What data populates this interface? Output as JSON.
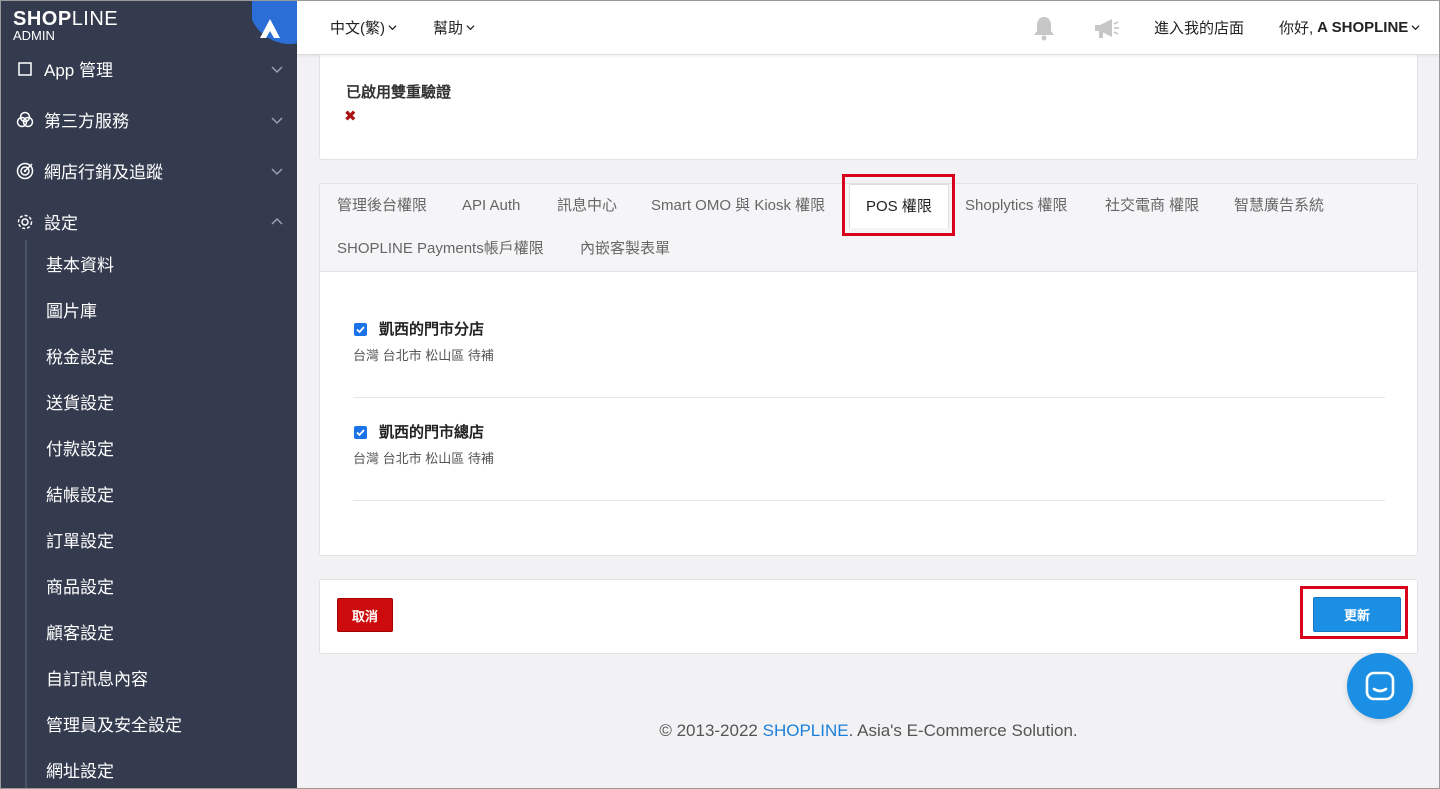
{
  "brand": {
    "logo_bold": "SHOP",
    "logo_thin": "LINE",
    "sub": "ADMIN"
  },
  "sidebar": {
    "items": [
      {
        "label": "App 管理",
        "icon": "app-icon"
      },
      {
        "label": "第三方服務",
        "icon": "third-party-icon"
      },
      {
        "label": "網店行銷及追蹤",
        "icon": "target-icon"
      },
      {
        "label": "設定",
        "icon": "gear-icon"
      }
    ],
    "settings_subitems": [
      "基本資料",
      "圖片庫",
      "稅金設定",
      "送貨設定",
      "付款設定",
      "結帳設定",
      "訂單設定",
      "商品設定",
      "顧客設定",
      "自訂訊息內容",
      "管理員及安全設定",
      "網址設定"
    ]
  },
  "topbar": {
    "language": "中文(繁)",
    "help": "幫助",
    "enter_store": "進入我的店面",
    "greeting": "你好, ",
    "user": "A SHOPLINE"
  },
  "security": {
    "two_factor_label": "已啟用雙重驗證",
    "two_factor_value": "✖"
  },
  "tabs": [
    "管理後台權限",
    "API Auth",
    "訊息中心",
    "Smart OMO 與 Kiosk 權限",
    "POS 權限",
    "Shoplytics 權限",
    "社交電商 權限",
    "智慧廣告系統",
    "SHOPLINE Payments帳戶權限",
    "內嵌客製表單"
  ],
  "active_tab": "POS 權限",
  "stores": [
    {
      "name": "凱西的門市分店",
      "address": "台灣 台北市 松山區 待補",
      "checked": true
    },
    {
      "name": "凱西的門市總店",
      "address": "台灣 台北市 松山區 待補",
      "checked": true
    }
  ],
  "actions": {
    "cancel": "取消",
    "update": "更新"
  },
  "footer": {
    "prefix": "© 2013-2022 ",
    "brand": "SHOPLINE",
    "suffix": ". Asia's E-Commerce Solution."
  },
  "colors": {
    "sidebar": "#343b4e",
    "accent": "#1a8fe3",
    "danger": "#cc0c0c",
    "highlight": "#d9001b"
  }
}
